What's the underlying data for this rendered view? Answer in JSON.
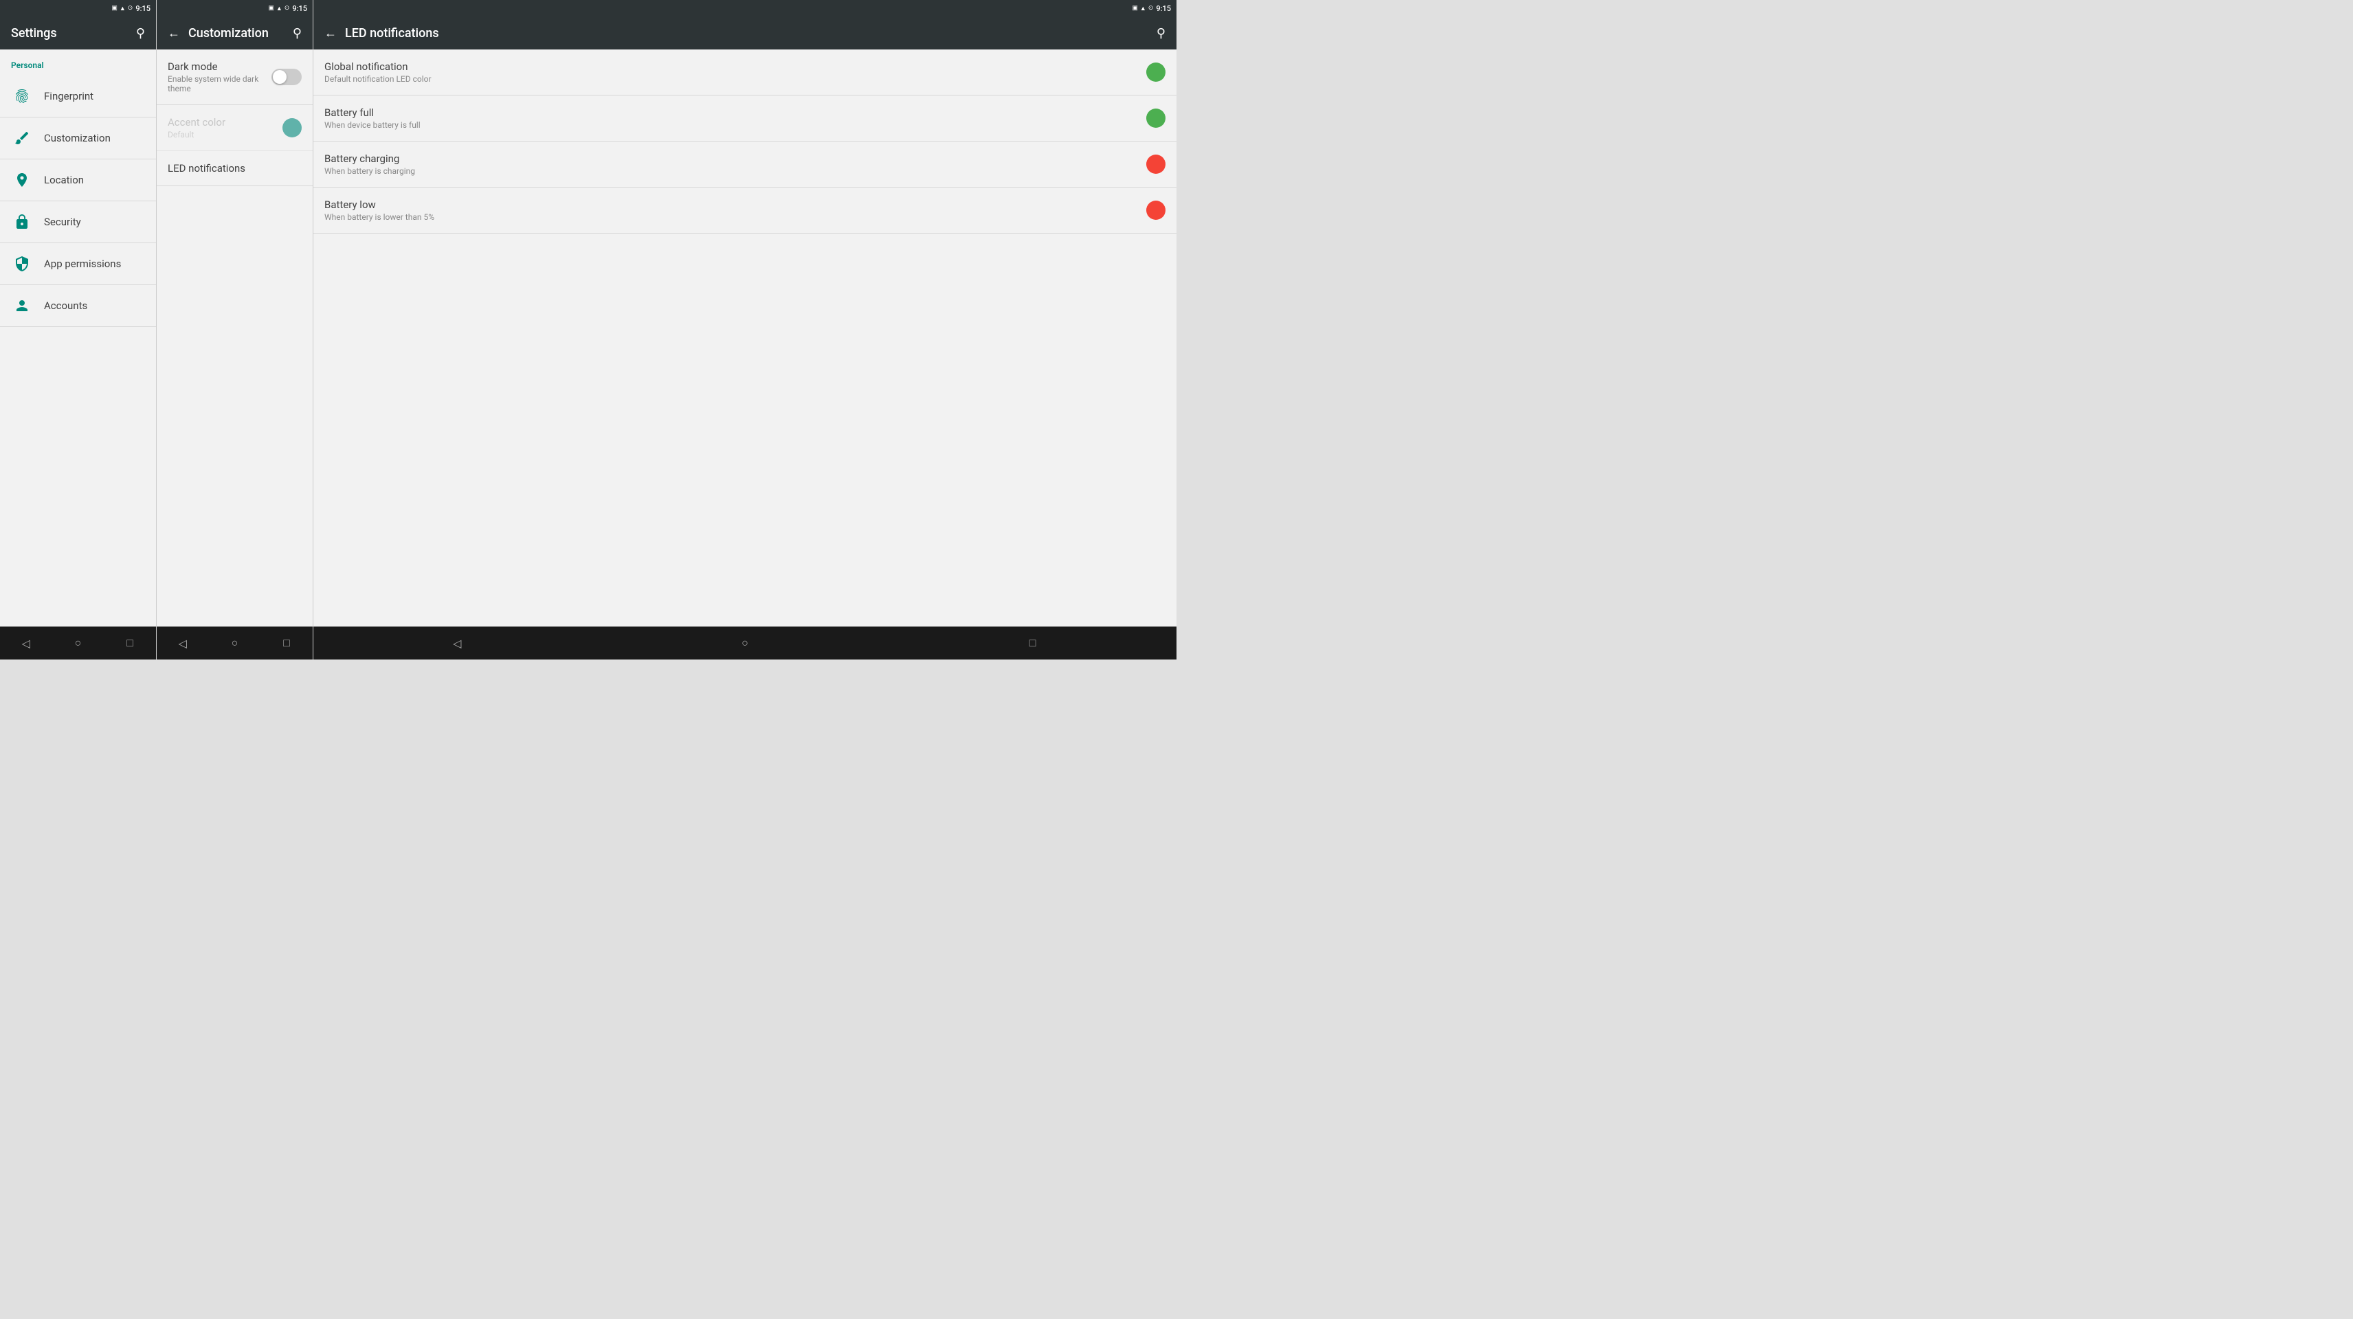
{
  "colors": {
    "teal": "#00897b",
    "darkBar": "#2d3436",
    "bottomNav": "#1a1a1a",
    "green": "#4caf50",
    "red": "#f44336",
    "textPrimary": "#424242",
    "textSecondary": "#888888"
  },
  "panel1": {
    "statusTime": "9:15",
    "appBarTitle": "Settings",
    "sectionLabel": "Personal",
    "menuItems": [
      {
        "id": "fingerprint",
        "label": "Fingerprint",
        "icon": "fingerprint"
      },
      {
        "id": "customization",
        "label": "Customization",
        "icon": "brush"
      },
      {
        "id": "location",
        "label": "Location",
        "icon": "location"
      },
      {
        "id": "security",
        "label": "Security",
        "icon": "security"
      },
      {
        "id": "app-permissions",
        "label": "App permissions",
        "icon": "shield"
      },
      {
        "id": "accounts",
        "label": "Accounts",
        "icon": "person"
      }
    ],
    "bottomNav": {
      "back": "◁",
      "home": "○",
      "recents": "□"
    }
  },
  "panel2": {
    "statusTime": "9:15",
    "appBarTitle": "Customization",
    "backLabel": "←",
    "settings": [
      {
        "id": "dark-mode",
        "title": "Dark mode",
        "subtitle": "Enable system wide dark theme",
        "type": "toggle",
        "value": false,
        "disabled": false
      },
      {
        "id": "accent-color",
        "title": "Accent color",
        "subtitle": "Default",
        "type": "color",
        "value": "#00897b",
        "disabled": true
      },
      {
        "id": "led-notifications",
        "title": "LED notifications",
        "subtitle": "",
        "type": "navigate",
        "disabled": false
      }
    ],
    "bottomNav": {
      "back": "◁",
      "home": "○",
      "recents": "□"
    }
  },
  "panel3": {
    "statusTime": "9:15",
    "appBarTitle": "LED notifications",
    "backLabel": "←",
    "notifications": [
      {
        "id": "global-notification",
        "title": "Global notification",
        "subtitle": "Default notification LED color",
        "dotColor": "green"
      },
      {
        "id": "battery-full",
        "title": "Battery full",
        "subtitle": "When device battery is full",
        "dotColor": "green"
      },
      {
        "id": "battery-charging",
        "title": "Battery charging",
        "subtitle": "When battery is charging",
        "dotColor": "red"
      },
      {
        "id": "battery-low",
        "title": "Battery low",
        "subtitle": "When battery is lower than 5%",
        "dotColor": "red"
      }
    ],
    "bottomNav": {
      "back": "◁",
      "home": "○",
      "recents": "□"
    }
  }
}
